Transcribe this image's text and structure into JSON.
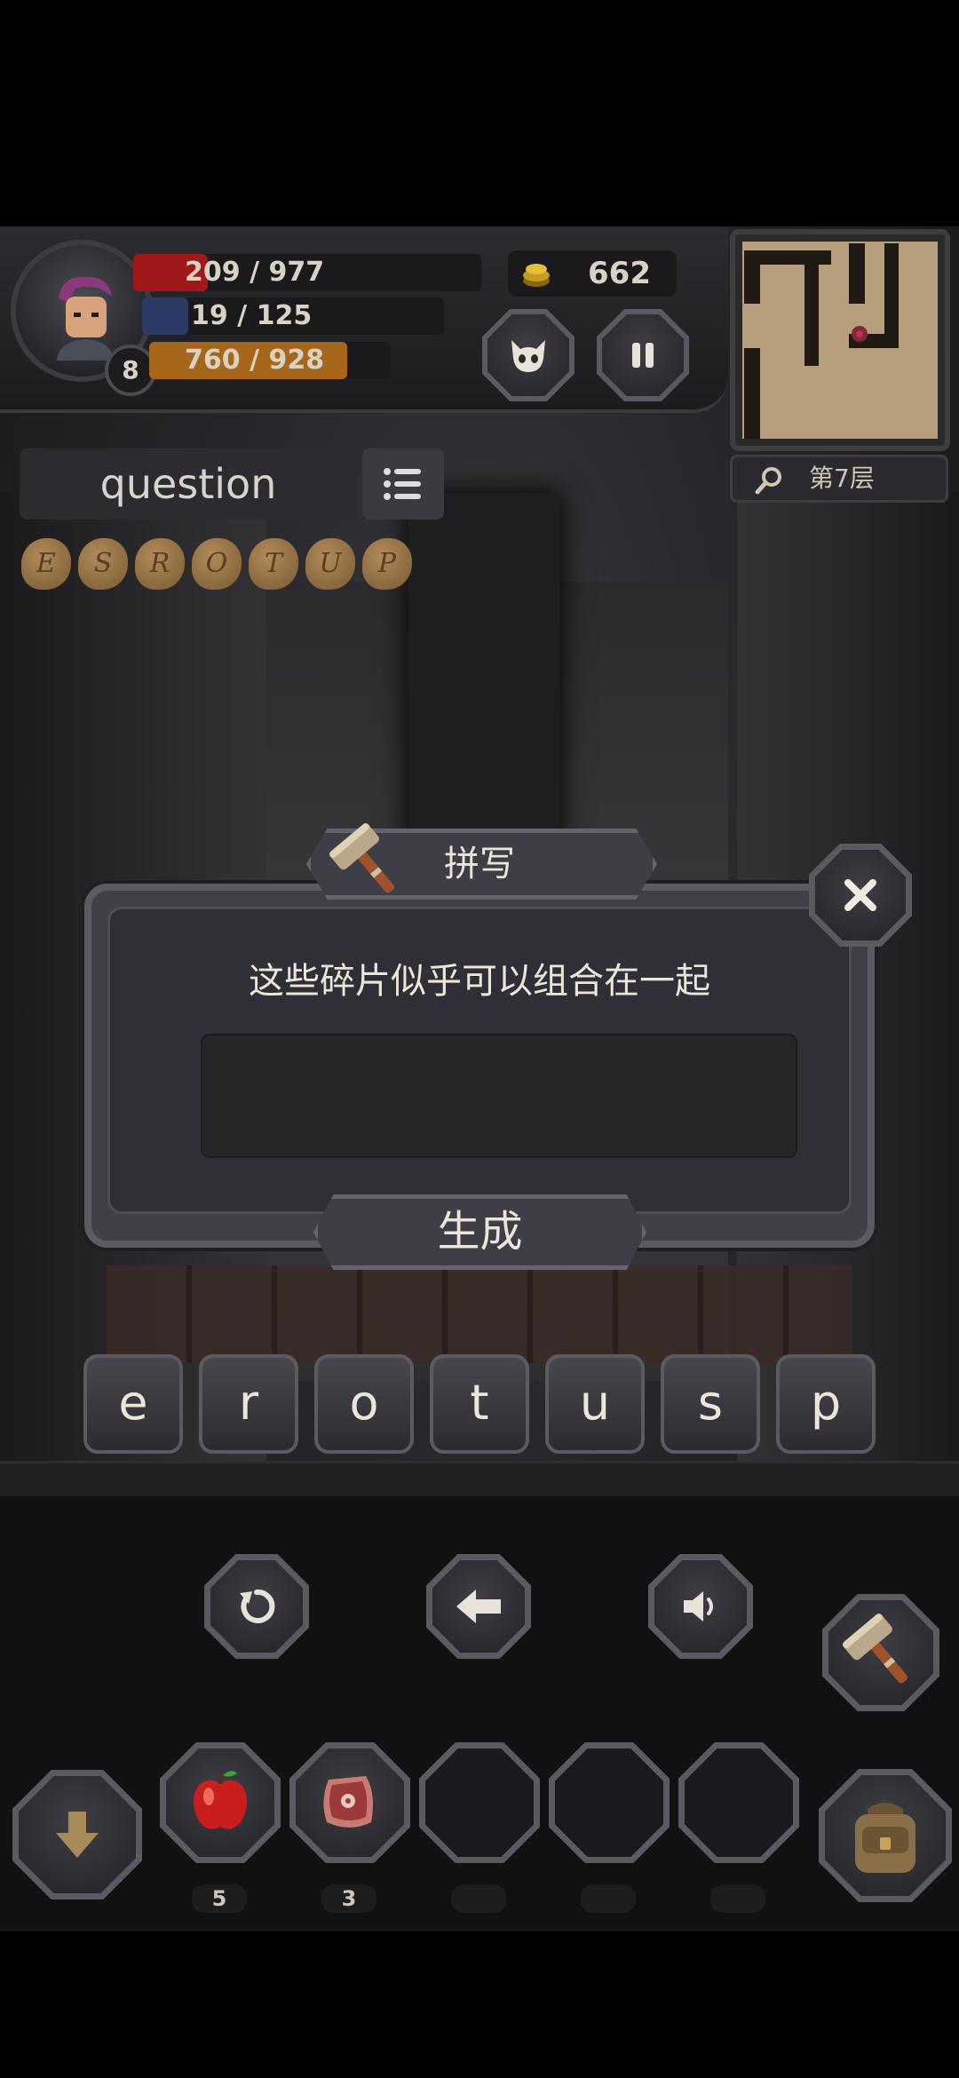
{
  "hud": {
    "player_level": "8",
    "hp_text": "209 / 977",
    "mp_text": "19 / 125",
    "xp_text": "760 / 928",
    "hp_fraction": 0.214,
    "mp_fraction": 0.152,
    "xp_fraction": 0.819,
    "gold": "662",
    "colors": {
      "hp": "#a01818",
      "xp": "#a8661a",
      "coin": "#c89a20"
    }
  },
  "minimap": {
    "floor_label": "第7层",
    "search_icon": "magnifier-icon"
  },
  "word": {
    "text": "question",
    "list_icon": "list-icon"
  },
  "fragments": [
    "E",
    "S",
    "R",
    "O",
    "T",
    "U",
    "P"
  ],
  "dialog": {
    "title": "拼写",
    "message": "这些碎片似乎可以组合在一起",
    "input_value": "",
    "generate_label": "生成",
    "close_icon": "close-icon"
  },
  "letters": [
    "e",
    "r",
    "o",
    "t",
    "u",
    "s",
    "p"
  ],
  "controls": [
    "reset-icon",
    "backspace-icon",
    "speaker-icon"
  ],
  "inventory": [
    {
      "icon": "apple-icon",
      "count": "5"
    },
    {
      "icon": "meat-icon",
      "count": "3"
    },
    {
      "icon": "",
      "count": ""
    },
    {
      "icon": "",
      "count": ""
    },
    {
      "icon": "",
      "count": ""
    }
  ]
}
